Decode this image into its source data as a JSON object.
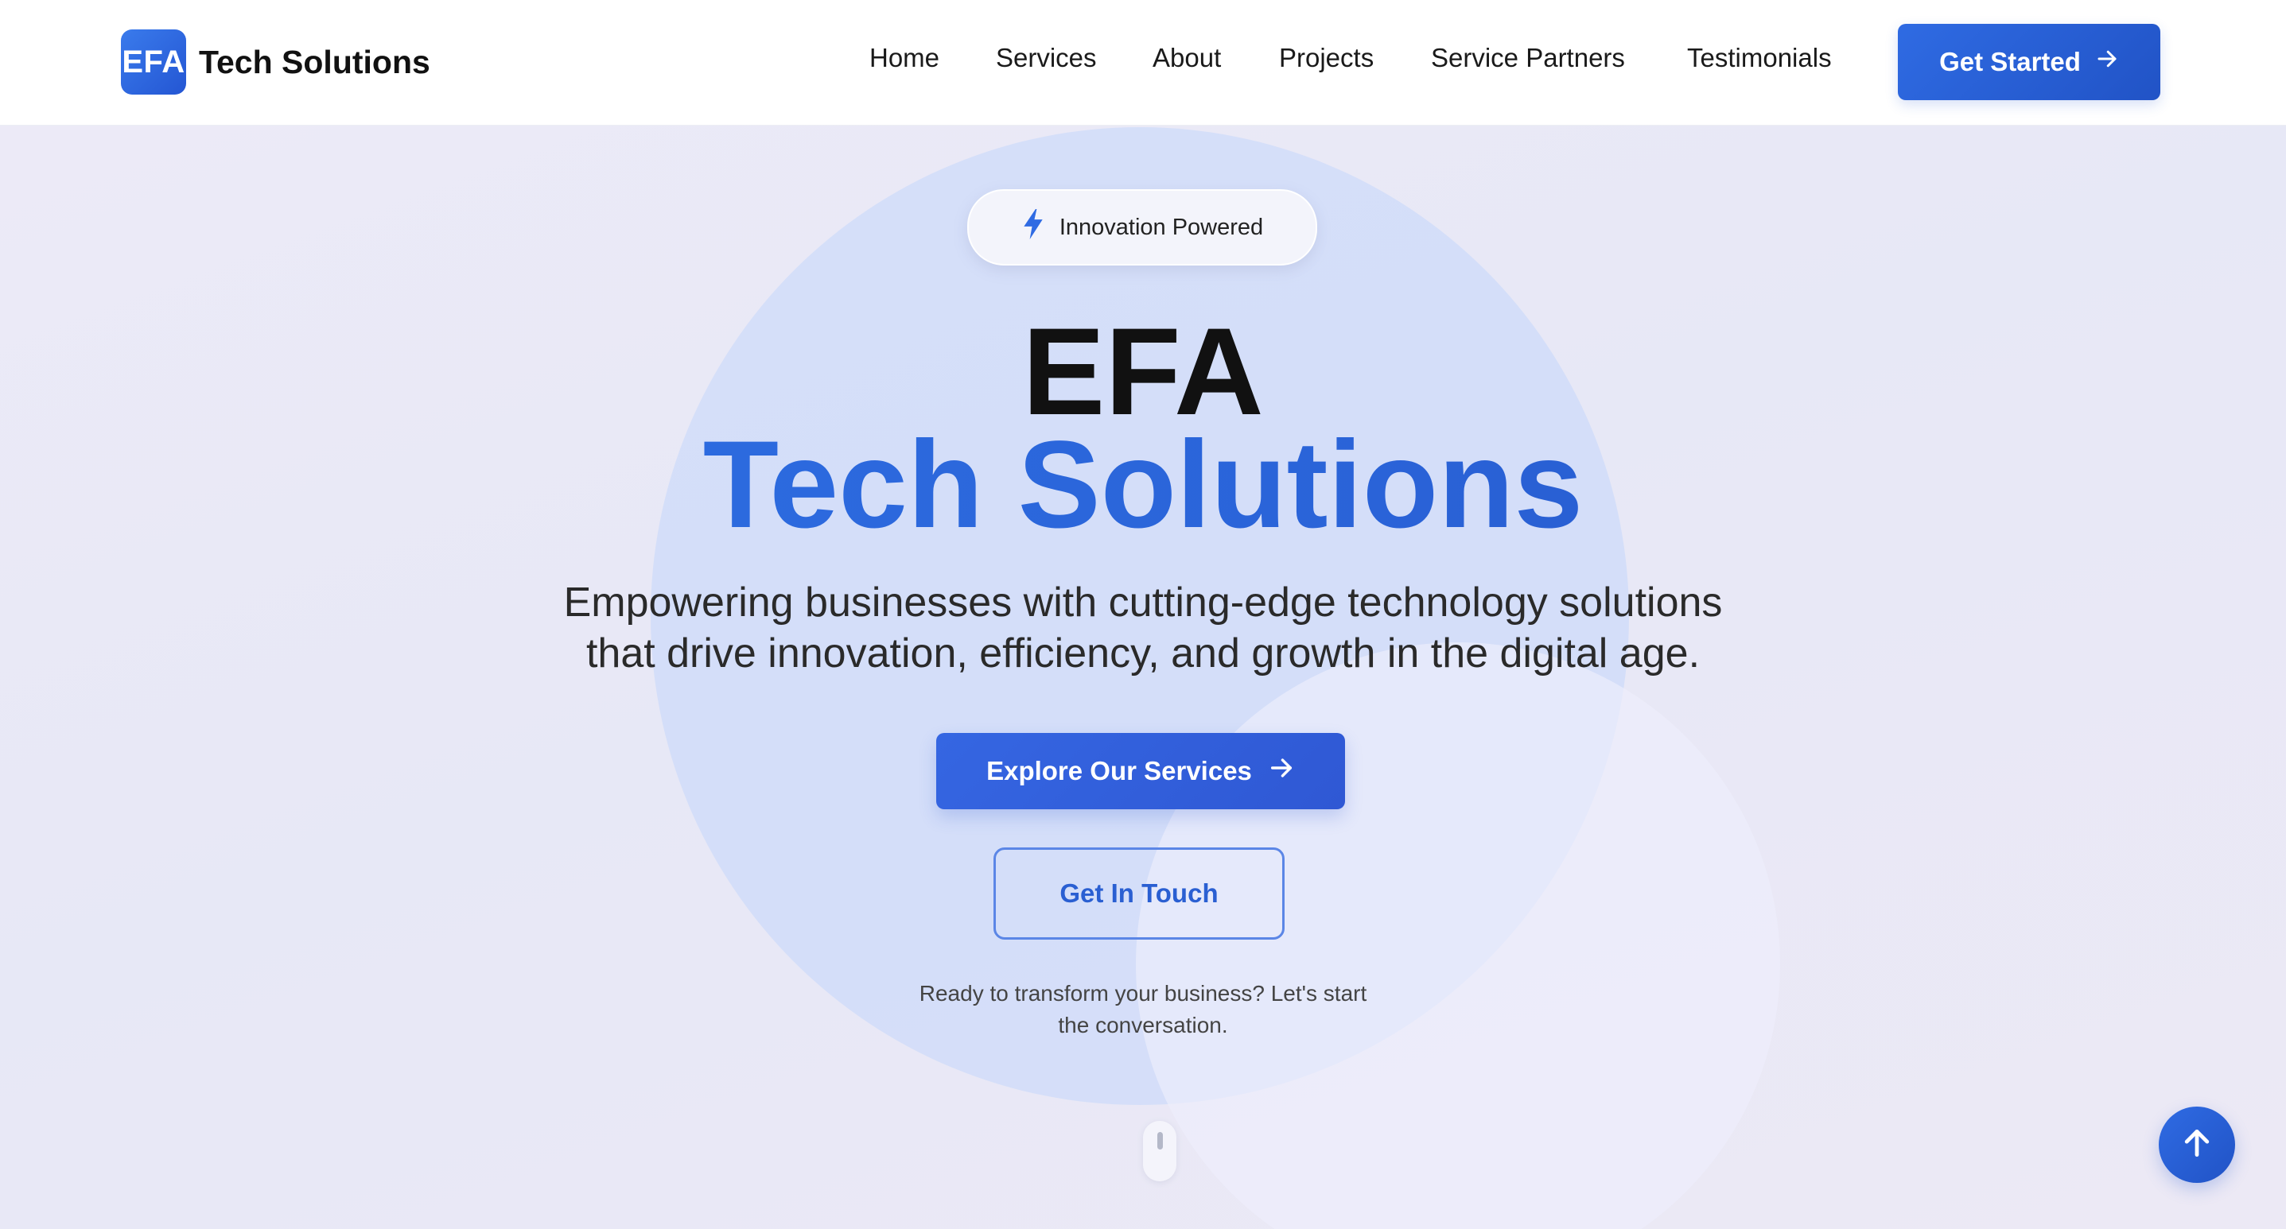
{
  "header": {
    "logo_badge": "EFA",
    "logo_text": "Tech Solutions",
    "nav": [
      {
        "label": "Home"
      },
      {
        "label": "Services"
      },
      {
        "label": "About"
      },
      {
        "label": "Projects"
      },
      {
        "label": "Service Partners"
      },
      {
        "label": "Testimonials"
      }
    ],
    "cta_label": "Get Started",
    "cta_icon": "arrow-right-icon"
  },
  "hero": {
    "badge_icon": "lightning-icon",
    "badge_label": "Innovation Powered",
    "title_line1": "EFA",
    "title_line2": "Tech Solutions",
    "subtitle_line1": "Empowering businesses with cutting-edge technology solutions",
    "subtitle_line2": "that drive innovation, efficiency, and growth in the digital age.",
    "primary_button": "Explore Our Services",
    "primary_button_icon": "arrow-right-icon",
    "secondary_button": "Get In Touch",
    "tagline_line1": "Ready to transform your business? Let's start",
    "tagline_line2": "the conversation."
  },
  "widgets": {
    "scroll_indicator_icon": "mouse-scroll-icon",
    "back_to_top_icon": "arrow-up-icon"
  },
  "colors": {
    "brand_blue": "#2f6be3",
    "brand_blue_dark": "#2153c6",
    "title_gradient_start": "#2f72e6",
    "hero_background": "#eceaf7",
    "text_dark": "#111111"
  }
}
